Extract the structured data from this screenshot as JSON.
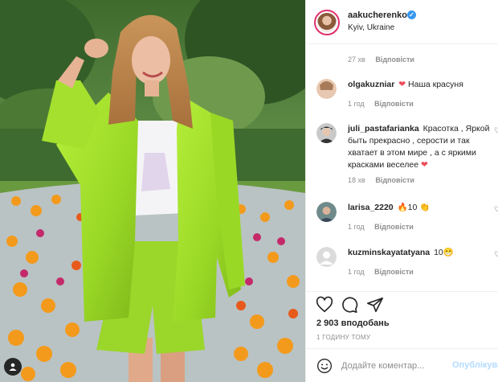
{
  "post": {
    "username": "aakucherenko",
    "location": "Kyiv, Ukraine",
    "caption_meta": {
      "age": "27 хв",
      "reply_label": "Відповісти"
    }
  },
  "comments": [
    {
      "username": "olgakuzniar",
      "text": "Наша красуня",
      "age": "1 год",
      "reply_label": "Відповісти",
      "emoji": "heart"
    },
    {
      "username": "juli_pastafarianka",
      "text": "Красотка , Яркой быть прекрасно , серости и так хватает в этом мире , а с яркими красками веселее",
      "age": "18 хв",
      "reply_label": "Відповісти",
      "emoji": "heart"
    },
    {
      "username": "larisa_2220",
      "text": "10",
      "age": "1 год",
      "reply_label": "Відповісти",
      "emoji": "fire-clap"
    },
    {
      "username": "kuzminskayatatyana",
      "text": "10",
      "age": "1 год",
      "reply_label": "Відповісти",
      "emoji": "laugh"
    }
  ],
  "actions": {
    "likes": "2 903 вподобань",
    "time": "1 ГОДИНУ ТОМУ"
  },
  "add_comment": {
    "placeholder": "Додайте коментар...",
    "post_label": "Опублікува"
  },
  "icons": [
    "verified-badge-icon",
    "heart-icon",
    "comment-icon",
    "share-icon",
    "emoji-icon",
    "user-tag-icon"
  ],
  "colors": {
    "accent": "#3897f0",
    "heart": "#ed4956",
    "post_disabled": "#b3dbff",
    "meta": "#8e8e8e"
  }
}
